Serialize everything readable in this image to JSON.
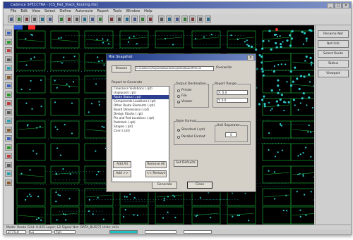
{
  "window": {
    "title": "Cadence SPECCTRA - [CS_Pad_Stack_Routing.rte]"
  },
  "menu": [
    "File",
    "Edit",
    "View",
    "Select",
    "Define",
    "Autoroute",
    "Report",
    "Tools",
    "Window",
    "Help"
  ],
  "right_panel": [
    "Rename Net",
    "Net Info",
    "Select Route",
    "Status",
    "Viewport"
  ],
  "dialog": {
    "title": "Rte Snapshot",
    "browse_label": "Browse",
    "path_value": "C:\\Cadence\\Projects\\Boards\\SnapTest\\BoardPCB.rte",
    "suffix_label": "Overwrite",
    "list_label": "Report to Generate",
    "list_items": [
      "Clearance Violations (.rpt)",
      "Unplaced (.rpt)",
      "Route Status (.rpt)",
      "Components Locations (.rpt)",
      "Other Route Elements (.rpt)",
      "Board Dimensions (.rpt)",
      "Design Stacks (.rpt)",
      "Pin and Pad Locations (.rpt)",
      "Padstack (.rpt)",
      "Shapes (.rpt)",
      "Conn (.rpt)"
    ],
    "selected_index": 2,
    "output_group_label": "Output Destination",
    "output_options": [
      "Printer",
      "File",
      "Viewer"
    ],
    "output_selected": 2,
    "range_group_label": "Report Range",
    "range_x": "X: 0.0",
    "range_y": "Y: 0.0",
    "style_group_label": "Style Format",
    "style_options": [
      "Standard (.rpt)",
      "Parallel Format"
    ],
    "style_selected": 0,
    "unit_group_label": "Unit Separator",
    "unit_value": "0",
    "left_buttons": [
      "Add All",
      "Remove All",
      "Add >>",
      "<< Remove"
    ],
    "mid_button": "Set Defaults",
    "ok_label": "Generate",
    "cancel_label": "Close"
  },
  "status": {
    "text": "Mode: Route  Grid: 0.025  Layer: L2 Signal  Net: DATA_BUS[7]  Units: mils"
  },
  "bottom": {
    "coord": "2775.0",
    "layer": "L1",
    "grid": "Full"
  },
  "colors": {
    "canvas": "#000000",
    "pad": "#2ec7c7",
    "trace": "#1aa832",
    "select": "#ff3030"
  }
}
